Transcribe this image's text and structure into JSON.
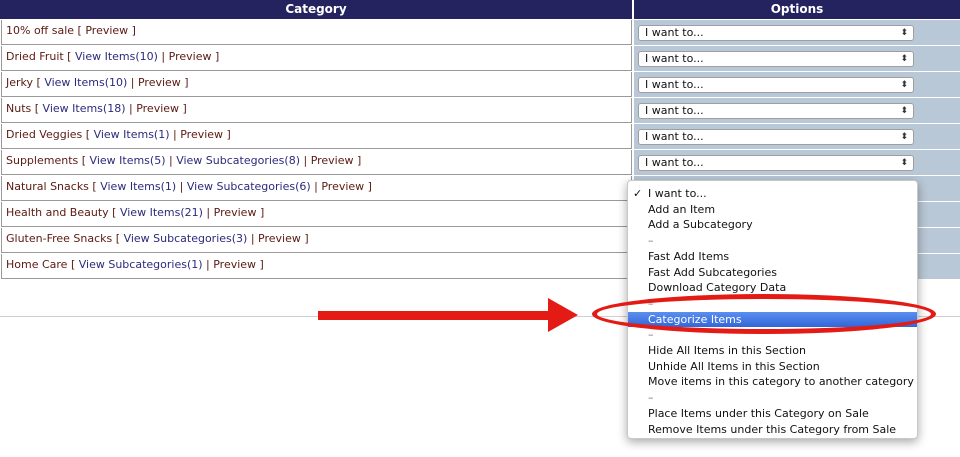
{
  "header": {
    "category": "Category",
    "options": "Options"
  },
  "select_label": "I want to...",
  "rows": [
    {
      "name": "10% off sale",
      "view_items": "",
      "view_subcategories": "",
      "preview": "Preview"
    },
    {
      "name": "Dried Fruit",
      "view_items": "View Items(10)",
      "view_subcategories": "",
      "preview": "Preview"
    },
    {
      "name": "Jerky",
      "view_items": "View Items(10)",
      "view_subcategories": "",
      "preview": "Preview"
    },
    {
      "name": "Nuts",
      "view_items": "View Items(18)",
      "view_subcategories": "",
      "preview": "Preview"
    },
    {
      "name": "Dried Veggies",
      "view_items": "View Items(1)",
      "view_subcategories": "",
      "preview": "Preview"
    },
    {
      "name": "Supplements",
      "view_items": "View Items(5)",
      "view_subcategories": "View Subcategories(8)",
      "preview": "Preview"
    },
    {
      "name": "Natural Snacks",
      "view_items": "View Items(1)",
      "view_subcategories": "View Subcategories(6)",
      "preview": "Preview"
    },
    {
      "name": "Health and Beauty",
      "view_items": "View Items(21)",
      "view_subcategories": "",
      "preview": "Preview"
    },
    {
      "name": "Gluten-Free Snacks",
      "view_items": "",
      "view_subcategories": "View Subcategories(3)",
      "preview": "Preview"
    },
    {
      "name": "Home Care",
      "view_items": "",
      "view_subcategories": "View Subcategories(1)",
      "preview": "Preview"
    }
  ],
  "dropdown": {
    "items": [
      {
        "label": "I want to...",
        "checked": true
      },
      {
        "label": "Add an Item"
      },
      {
        "label": "Add a Subcategory"
      },
      {
        "label": "–",
        "separator": true
      },
      {
        "label": "Fast Add Items"
      },
      {
        "label": "Fast Add Subcategories"
      },
      {
        "label": "Download Category Data"
      },
      {
        "label": "–",
        "separator": true
      },
      {
        "label": "Categorize Items",
        "highlighted": true
      },
      {
        "label": "–",
        "separator": true
      },
      {
        "label": "Hide All Items in this Section"
      },
      {
        "label": "Unhide All Items in this Section"
      },
      {
        "label": "Move items in this category to another category"
      },
      {
        "label": "–",
        "separator": true
      },
      {
        "label": "Place Items under this Category on Sale"
      },
      {
        "label": "Remove Items under this Category from Sale"
      }
    ]
  },
  "colors": {
    "header_bg": "#24235f",
    "options_bg": "#b9c8d6",
    "highlight": "#3266d8",
    "annotation": "#e41b15"
  }
}
